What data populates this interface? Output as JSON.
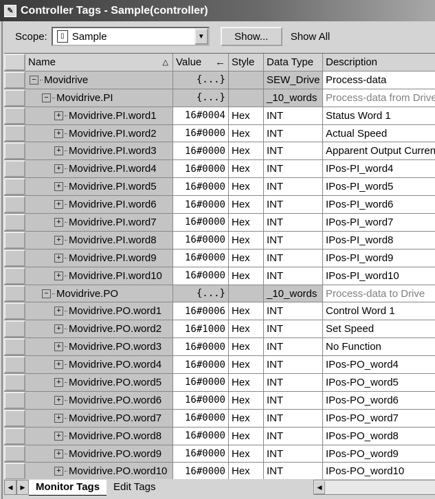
{
  "window": {
    "title": "Controller Tags - Sample(controller)"
  },
  "toolbar": {
    "scope_label": "Scope:",
    "scope_value": "Sample",
    "show_button": "Show...",
    "show_filter": "Show All"
  },
  "columns": [
    "Name",
    "Value",
    "Style",
    "Data Type",
    "Description"
  ],
  "sort_indicator": "△",
  "value_arrow": "←",
  "rows": [
    {
      "indent": 0,
      "exp": "−",
      "name": "Movidrive",
      "value": "{...}",
      "style": "",
      "type": "SEW_Drive",
      "desc": "Process-data",
      "struct": true,
      "faint": false
    },
    {
      "indent": 1,
      "exp": "−",
      "name": "Movidrive.PI",
      "value": "{...}",
      "style": "",
      "type": "_10_words",
      "desc": "Process-data from Drive",
      "struct": true,
      "faint": true
    },
    {
      "indent": 2,
      "exp": "+",
      "name": "Movidrive.PI.word1",
      "value": "16#0004",
      "style": "Hex",
      "type": "INT",
      "desc": "Status Word 1"
    },
    {
      "indent": 2,
      "exp": "+",
      "name": "Movidrive.PI.word2",
      "value": "16#0000",
      "style": "Hex",
      "type": "INT",
      "desc": "Actual Speed"
    },
    {
      "indent": 2,
      "exp": "+",
      "name": "Movidrive.PI.word3",
      "value": "16#0000",
      "style": "Hex",
      "type": "INT",
      "desc": "Apparent Output Current"
    },
    {
      "indent": 2,
      "exp": "+",
      "name": "Movidrive.PI.word4",
      "value": "16#0000",
      "style": "Hex",
      "type": "INT",
      "desc": "IPos-PI_word4"
    },
    {
      "indent": 2,
      "exp": "+",
      "name": "Movidrive.PI.word5",
      "value": "16#0000",
      "style": "Hex",
      "type": "INT",
      "desc": "IPos-PI_word5"
    },
    {
      "indent": 2,
      "exp": "+",
      "name": "Movidrive.PI.word6",
      "value": "16#0000",
      "style": "Hex",
      "type": "INT",
      "desc": "IPos-PI_word6"
    },
    {
      "indent": 2,
      "exp": "+",
      "name": "Movidrive.PI.word7",
      "value": "16#0000",
      "style": "Hex",
      "type": "INT",
      "desc": "IPos-PI_word7"
    },
    {
      "indent": 2,
      "exp": "+",
      "name": "Movidrive.PI.word8",
      "value": "16#0000",
      "style": "Hex",
      "type": "INT",
      "desc": "IPos-PI_word8"
    },
    {
      "indent": 2,
      "exp": "+",
      "name": "Movidrive.PI.word9",
      "value": "16#0000",
      "style": "Hex",
      "type": "INT",
      "desc": "IPos-PI_word9"
    },
    {
      "indent": 2,
      "exp": "+",
      "name": "Movidrive.PI.word10",
      "value": "16#0000",
      "style": "Hex",
      "type": "INT",
      "desc": "IPos-PI_word10"
    },
    {
      "indent": 1,
      "exp": "−",
      "name": "Movidrive.PO",
      "value": "{...}",
      "style": "",
      "type": "_10_words",
      "desc": "Process-data to Drive",
      "struct": true,
      "faint": true
    },
    {
      "indent": 2,
      "exp": "+",
      "name": "Movidrive.PO.word1",
      "value": "16#0006",
      "style": "Hex",
      "type": "INT",
      "desc": "Control Word 1"
    },
    {
      "indent": 2,
      "exp": "+",
      "name": "Movidrive.PO.word2",
      "value": "16#1000",
      "style": "Hex",
      "type": "INT",
      "desc": "Set Speed"
    },
    {
      "indent": 2,
      "exp": "+",
      "name": "Movidrive.PO.word3",
      "value": "16#0000",
      "style": "Hex",
      "type": "INT",
      "desc": "No Function"
    },
    {
      "indent": 2,
      "exp": "+",
      "name": "Movidrive.PO.word4",
      "value": "16#0000",
      "style": "Hex",
      "type": "INT",
      "desc": "IPos-PO_word4"
    },
    {
      "indent": 2,
      "exp": "+",
      "name": "Movidrive.PO.word5",
      "value": "16#0000",
      "style": "Hex",
      "type": "INT",
      "desc": "IPos-PO_word5"
    },
    {
      "indent": 2,
      "exp": "+",
      "name": "Movidrive.PO.word6",
      "value": "16#0000",
      "style": "Hex",
      "type": "INT",
      "desc": "IPos-PO_word6"
    },
    {
      "indent": 2,
      "exp": "+",
      "name": "Movidrive.PO.word7",
      "value": "16#0000",
      "style": "Hex",
      "type": "INT",
      "desc": "IPos-PO_word7"
    },
    {
      "indent": 2,
      "exp": "+",
      "name": "Movidrive.PO.word8",
      "value": "16#0000",
      "style": "Hex",
      "type": "INT",
      "desc": "IPos-PO_word8"
    },
    {
      "indent": 2,
      "exp": "+",
      "name": "Movidrive.PO.word9",
      "value": "16#0000",
      "style": "Hex",
      "type": "INT",
      "desc": "IPos-PO_word9"
    },
    {
      "indent": 2,
      "exp": "+",
      "name": "Movidrive.PO.word10",
      "value": "16#0000",
      "style": "Hex",
      "type": "INT",
      "desc": "IPos-PO_word10"
    }
  ],
  "tabs": [
    {
      "label": "Monitor Tags",
      "active": true
    },
    {
      "label": "Edit Tags",
      "active": false
    }
  ]
}
